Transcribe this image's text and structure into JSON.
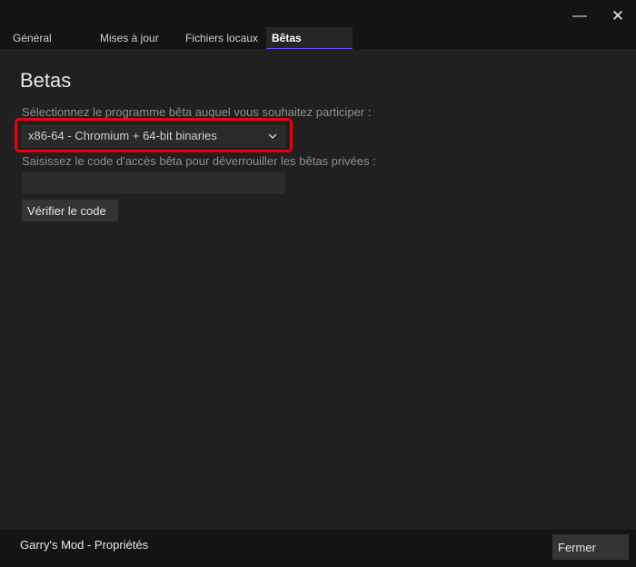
{
  "window": {
    "minimize_glyph": "—",
    "close_glyph": "✕"
  },
  "tabs": [
    {
      "label": "Général",
      "active": false
    },
    {
      "label": "Mises à jour",
      "active": false
    },
    {
      "label": "Fichiers locaux",
      "active": false
    },
    {
      "label": "Bêtas",
      "active": true
    }
  ],
  "page": {
    "heading": "Betas",
    "select_prompt": "Sélectionnez le programme bêta auquel vous souhaitez participer :",
    "selected_beta": "x86-64 - Chromium + 64-bit binaries",
    "code_prompt": "Saisissez le code d'accès bêta pour déverrouiller les bêtas privées :",
    "code_value": "",
    "verify_button": "Vérifier le code"
  },
  "footer": {
    "title": "Garry's Mod - Propriétés",
    "close_button": "Fermer"
  },
  "colors": {
    "highlight": "#e8000d",
    "active_tab_underline": "#6a4cff"
  }
}
